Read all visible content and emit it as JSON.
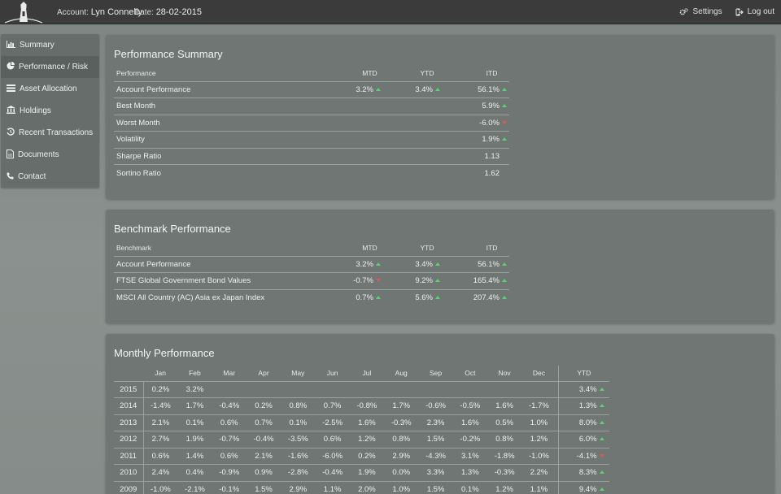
{
  "header": {
    "account_label": "Account:",
    "account_name": "Lyn Connelly",
    "date_label": "Date:",
    "date_value": "28-02-2015",
    "settings_label": "Settings",
    "logout_label": "Log out"
  },
  "sidebar": {
    "items": [
      {
        "label": "Summary",
        "icon": "bar-chart-icon"
      },
      {
        "label": "Performance / Risk",
        "icon": "pie-chart-icon"
      },
      {
        "label": "Asset Allocation",
        "icon": "list-icon"
      },
      {
        "label": "Holdings",
        "icon": "bank-icon"
      },
      {
        "label": "Recent Transactions",
        "icon": "history-icon"
      },
      {
        "label": "Documents",
        "icon": "document-icon"
      },
      {
        "label": "Contact",
        "icon": "phone-icon"
      }
    ],
    "active_index": 1
  },
  "performance_summary": {
    "title": "Performance Summary",
    "headers": [
      "Performance",
      "MTD",
      "YTD",
      "ITD"
    ],
    "rows": [
      {
        "label": "Account Performance",
        "mtd": "3.2%",
        "mtd_dir": "up",
        "ytd": "3.4%",
        "ytd_dir": "up",
        "itd": "56.1%",
        "itd_dir": "up"
      },
      {
        "label": "Best Month",
        "mtd": "",
        "mtd_dir": "",
        "ytd": "",
        "ytd_dir": "",
        "itd": "5.9%",
        "itd_dir": "up"
      },
      {
        "label": "Worst Month",
        "mtd": "",
        "mtd_dir": "",
        "ytd": "",
        "ytd_dir": "",
        "itd": "-6.0%",
        "itd_dir": "down"
      },
      {
        "label": "Volatility",
        "mtd": "",
        "mtd_dir": "",
        "ytd": "",
        "ytd_dir": "",
        "itd": "1.9%",
        "itd_dir": "up"
      },
      {
        "label": "Sharpe Ratio",
        "mtd": "",
        "mtd_dir": "",
        "ytd": "",
        "ytd_dir": "",
        "itd": "1.13",
        "itd_dir": "none"
      },
      {
        "label": "Sortino Ratio",
        "mtd": "",
        "mtd_dir": "",
        "ytd": "",
        "ytd_dir": "",
        "itd": "1.62",
        "itd_dir": "none"
      }
    ]
  },
  "benchmark_performance": {
    "title": "Benchmark Performance",
    "headers": [
      "Benchmark",
      "MTD",
      "YTD",
      "ITD"
    ],
    "rows": [
      {
        "label": "Account Performance",
        "mtd": "3.2%",
        "mtd_dir": "up",
        "ytd": "3.4%",
        "ytd_dir": "up",
        "itd": "56.1%",
        "itd_dir": "up"
      },
      {
        "label": "FTSE Global Government Bond Values",
        "mtd": "-0.7%",
        "mtd_dir": "down",
        "ytd": "9.2%",
        "ytd_dir": "up",
        "itd": "165.4%",
        "itd_dir": "up"
      },
      {
        "label": "MSCI All Country (AC) Asia ex Japan Index",
        "mtd": "0.7%",
        "mtd_dir": "up",
        "ytd": "5.6%",
        "ytd_dir": "up",
        "itd": "207.4%",
        "itd_dir": "up"
      }
    ]
  },
  "monthly_performance": {
    "title": "Monthly Performance",
    "months": [
      "Jan",
      "Feb",
      "Mar",
      "Apr",
      "May",
      "Jun",
      "Jul",
      "Aug",
      "Sep",
      "Oct",
      "Nov",
      "Dec"
    ],
    "ytd_header": "YTD",
    "rows": [
      {
        "year": "2015",
        "values": [
          "0.2%",
          "3.2%",
          "",
          "",
          "",
          "",
          "",
          "",
          "",
          "",
          "",
          ""
        ],
        "ytd": "3.4%",
        "ytd_dir": "up"
      },
      {
        "year": "2014",
        "values": [
          "-1.4%",
          "1.7%",
          "-0.4%",
          "0.2%",
          "0.8%",
          "0.7%",
          "-0.8%",
          "1.7%",
          "-0.6%",
          "-0.5%",
          "1.6%",
          "-1.7%"
        ],
        "ytd": "1.3%",
        "ytd_dir": "up"
      },
      {
        "year": "2013",
        "values": [
          "2.1%",
          "0.1%",
          "0.6%",
          "0.7%",
          "0.1%",
          "-2.5%",
          "1.6%",
          "-0.3%",
          "2.3%",
          "1.6%",
          "0.5%",
          "1.0%"
        ],
        "ytd": "8.0%",
        "ytd_dir": "up"
      },
      {
        "year": "2012",
        "values": [
          "2.7%",
          "1.9%",
          "-0.7%",
          "-0.4%",
          "-3.5%",
          "0.6%",
          "1.2%",
          "0.8%",
          "1.5%",
          "-0.2%",
          "0.8%",
          "1.2%"
        ],
        "ytd": "6.0%",
        "ytd_dir": "up"
      },
      {
        "year": "2011",
        "values": [
          "0.6%",
          "1.4%",
          "0.6%",
          "2.1%",
          "-1.6%",
          "-6.0%",
          "0.2%",
          "2.9%",
          "-4.3%",
          "3.1%",
          "-1.8%",
          "-1.0%"
        ],
        "ytd": "-4.1%",
        "ytd_dir": "down"
      },
      {
        "year": "2010",
        "values": [
          "2.4%",
          "0.4%",
          "-0.9%",
          "0.9%",
          "-2.8%",
          "-0.4%",
          "1.9%",
          "0.0%",
          "3.3%",
          "1.3%",
          "-0.3%",
          "2.2%"
        ],
        "ytd": "8.3%",
        "ytd_dir": "up"
      },
      {
        "year": "2009",
        "values": [
          "-1.0%",
          "-2.1%",
          "-0.1%",
          "1.5%",
          "2.9%",
          "1.1%",
          "2.0%",
          "1.0%",
          "1.5%",
          "0.1%",
          "1.2%",
          "1.1%"
        ],
        "ytd": "9.4%",
        "ytd_dir": "up"
      }
    ]
  },
  "colors": {
    "up_arrow": "#5ad46e",
    "down_arrow": "#e05a4e",
    "topbar": "#3a3b3a",
    "panel": "#6f7674"
  }
}
